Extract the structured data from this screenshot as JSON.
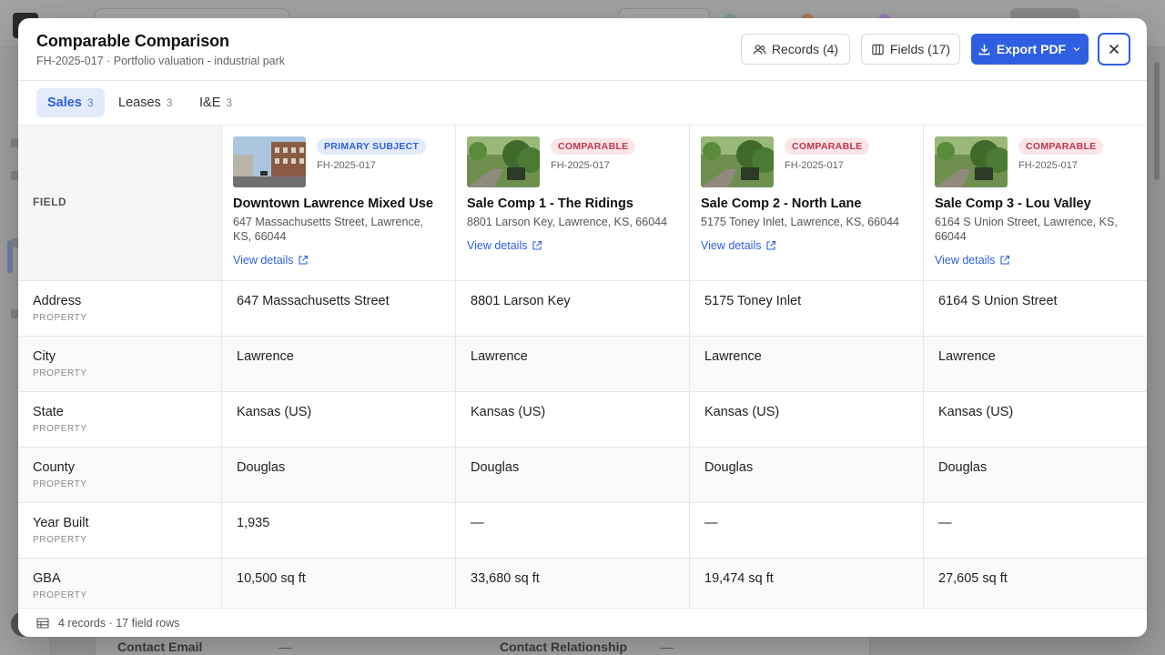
{
  "modal": {
    "title": "Comparable Comparison",
    "subtitle": "FH-2025-017 · Portfolio valuation - industrial park",
    "records_button": "Records (4)",
    "fields_button": "Fields (17)",
    "export_button": "Export PDF"
  },
  "tabs": [
    {
      "label": "Sales",
      "count": "3",
      "active": true
    },
    {
      "label": "Leases",
      "count": "3",
      "active": false
    },
    {
      "label": "I&E",
      "count": "3",
      "active": false
    }
  ],
  "grid": {
    "field_header": "FIELD",
    "view_details": "View details",
    "records": [
      {
        "badge": "PRIMARY SUBJECT",
        "badge_kind": "primary",
        "id": "FH-2025-017",
        "name": "Downtown Lawrence Mixed Use",
        "address": "647 Massachusetts Street, Lawrence, KS, 66044"
      },
      {
        "badge": "COMPARABLE",
        "badge_kind": "comp",
        "id": "FH-2025-017",
        "name": "Sale Comp 1 - The Ridings",
        "address": "8801 Larson Key, Lawrence, KS, 66044"
      },
      {
        "badge": "COMPARABLE",
        "badge_kind": "comp",
        "id": "FH-2025-017",
        "name": "Sale Comp 2 - North Lane",
        "address": "5175 Toney Inlet, Lawrence, KS, 66044"
      },
      {
        "badge": "COMPARABLE",
        "badge_kind": "comp",
        "id": "FH-2025-017",
        "name": "Sale Comp 3 - Lou Valley",
        "address": "6164 S Union Street, Lawrence, KS, 66044"
      }
    ],
    "rows": [
      {
        "label": "Address",
        "group": "PROPERTY",
        "values": [
          "647 Massachusetts Street",
          "8801 Larson Key",
          "5175 Toney Inlet",
          "6164 S Union Street"
        ]
      },
      {
        "label": "City",
        "group": "PROPERTY",
        "values": [
          "Lawrence",
          "Lawrence",
          "Lawrence",
          "Lawrence"
        ]
      },
      {
        "label": "State",
        "group": "PROPERTY",
        "values": [
          "Kansas (US)",
          "Kansas (US)",
          "Kansas (US)",
          "Kansas (US)"
        ]
      },
      {
        "label": "County",
        "group": "PROPERTY",
        "values": [
          "Douglas",
          "Douglas",
          "Douglas",
          "Douglas"
        ]
      },
      {
        "label": "Year Built",
        "group": "PROPERTY",
        "values": [
          "1,935",
          "—",
          "—",
          "—"
        ]
      },
      {
        "label": "GBA",
        "group": "PROPERTY",
        "values": [
          "10,500 sq ft",
          "33,680 sq ft",
          "19,474 sq ft",
          "27,605 sq ft"
        ]
      }
    ]
  },
  "footer": {
    "summary": "4 records · 17 field rows"
  },
  "background": {
    "contact_email_label": "Contact Email",
    "contact_email_value": "—",
    "contact_relationship_label": "Contact Relationship",
    "contact_relationship_value": "—"
  },
  "colors": {
    "accent": "#2f5fe0",
    "comparable_badge": "#c2334d"
  }
}
